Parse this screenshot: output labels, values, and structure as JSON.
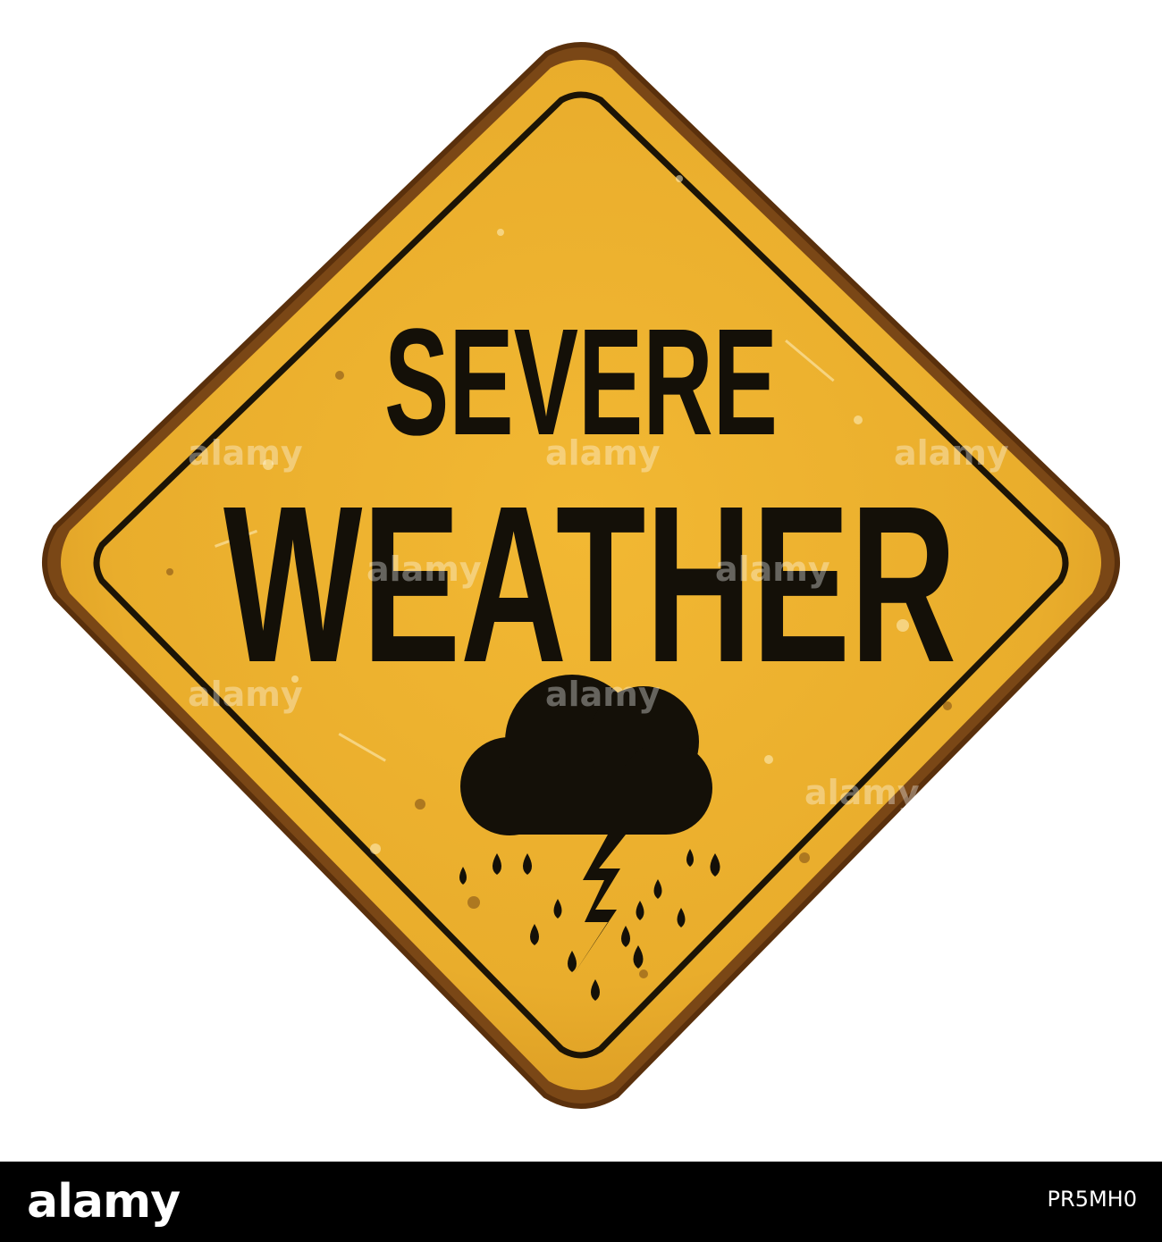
{
  "sign": {
    "line1": "SEVERE",
    "line2": "WEATHER",
    "icon": "storm-cloud-lightning-rain-icon",
    "colors": {
      "face": "#ecb02a",
      "ink": "#141008",
      "rust": "#6b3d14"
    }
  },
  "watermark": {
    "text": "alamy"
  },
  "footer": {
    "logo_text": "alamy",
    "image_id": "PR5MH0"
  }
}
